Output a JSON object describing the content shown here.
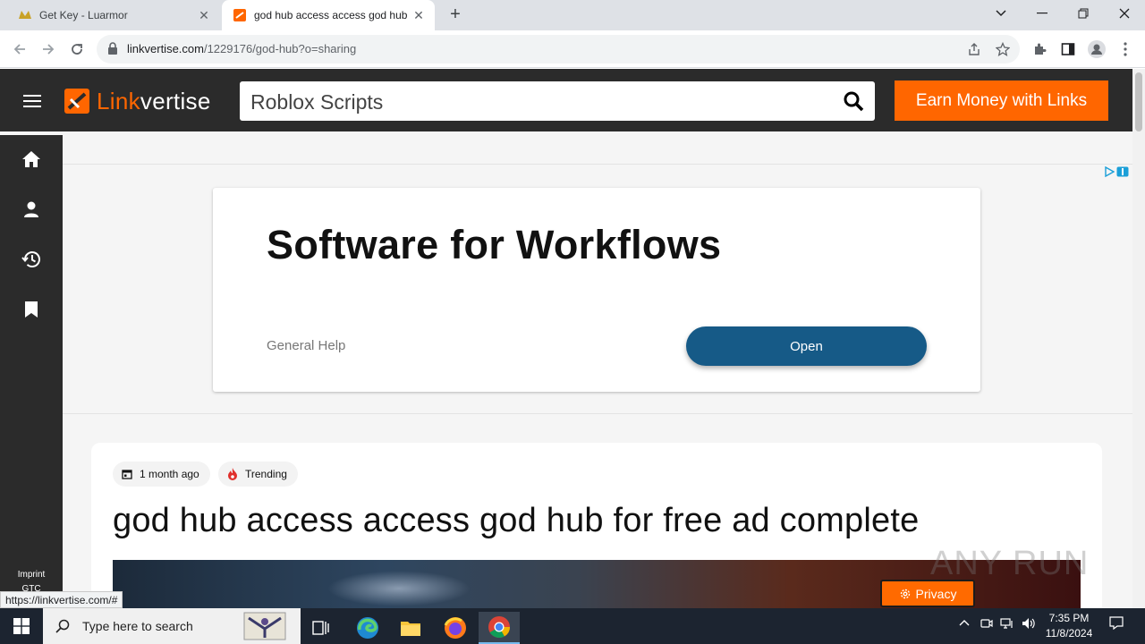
{
  "browser": {
    "tabs": [
      {
        "title": "Get Key - Luarmor",
        "close": "✕"
      },
      {
        "title": "god hub access access god hub",
        "close": "✕"
      }
    ],
    "new_tab": "+",
    "url_host": "linkvertise.com",
    "url_path": "/1229176/god-hub?o=sharing"
  },
  "header": {
    "logo_part1": "Link",
    "logo_part2": "vertise",
    "search_value": "Roblox Scripts",
    "earn_button": "Earn Money with Links"
  },
  "sidebar": {
    "icons": [
      "home-icon",
      "user-icon",
      "history-icon",
      "bookmark-icon"
    ],
    "imprint": "Imprint",
    "gtc": "GTC"
  },
  "ad": {
    "headline": "Software for Workflows",
    "subtext": "General Help",
    "button": "Open"
  },
  "post": {
    "date_chip": "1 month ago",
    "trend_chip": "Trending",
    "title": "god hub access access god hub for free ad complete"
  },
  "privacy_button": "Privacy",
  "watermark": "ANY RUN",
  "status_url": "https://linkvertise.com/#",
  "taskbar": {
    "search_placeholder": "Type here to search",
    "time": "7:35 PM",
    "date": "11/8/2024"
  },
  "colors": {
    "accent": "#ff6600",
    "nav_bg": "#2b2b2b",
    "ad_button": "#165a87"
  }
}
